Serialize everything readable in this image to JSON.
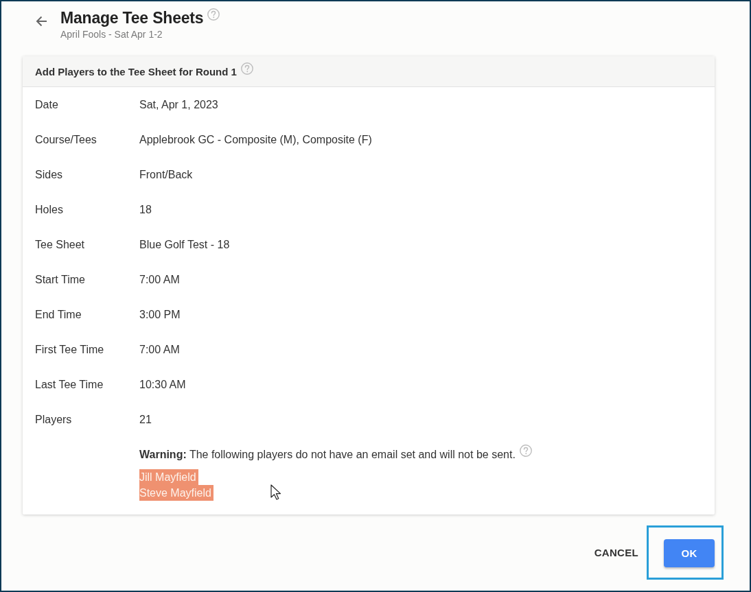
{
  "header": {
    "title": "Manage Tee Sheets",
    "subtitle": "April Fools - Sat Apr 1-2"
  },
  "card": {
    "title": "Add Players to the Tee Sheet for Round 1",
    "fields": [
      {
        "label": "Date",
        "value": "Sat, Apr 1, 2023"
      },
      {
        "label": "Course/Tees",
        "value": "Applebrook GC - Composite (M), Composite (F)"
      },
      {
        "label": "Sides",
        "value": "Front/Back"
      },
      {
        "label": "Holes",
        "value": "18"
      },
      {
        "label": "Tee Sheet",
        "value": "Blue Golf Test - 18"
      },
      {
        "label": "Start Time",
        "value": "7:00 AM"
      },
      {
        "label": "End Time",
        "value": "3:00 PM"
      },
      {
        "label": "First Tee Time",
        "value": "7:00 AM"
      },
      {
        "label": "Last Tee Time",
        "value": "10:30 AM"
      },
      {
        "label": "Players",
        "value": "21"
      }
    ],
    "warning": "**Warning:** The following players do not have an email set and will not be sent.",
    "players": [
      {
        "name": "Jill Mayfield",
        "highlighted": true
      },
      {
        "name": "Steve Mayfield",
        "highlighted": true
      }
    ]
  },
  "actions": [
    {
      "label": "CANCEL",
      "kind": "text",
      "focused": false
    },
    {
      "label": "OK",
      "kind": "primary",
      "focused": true
    }
  ]
}
